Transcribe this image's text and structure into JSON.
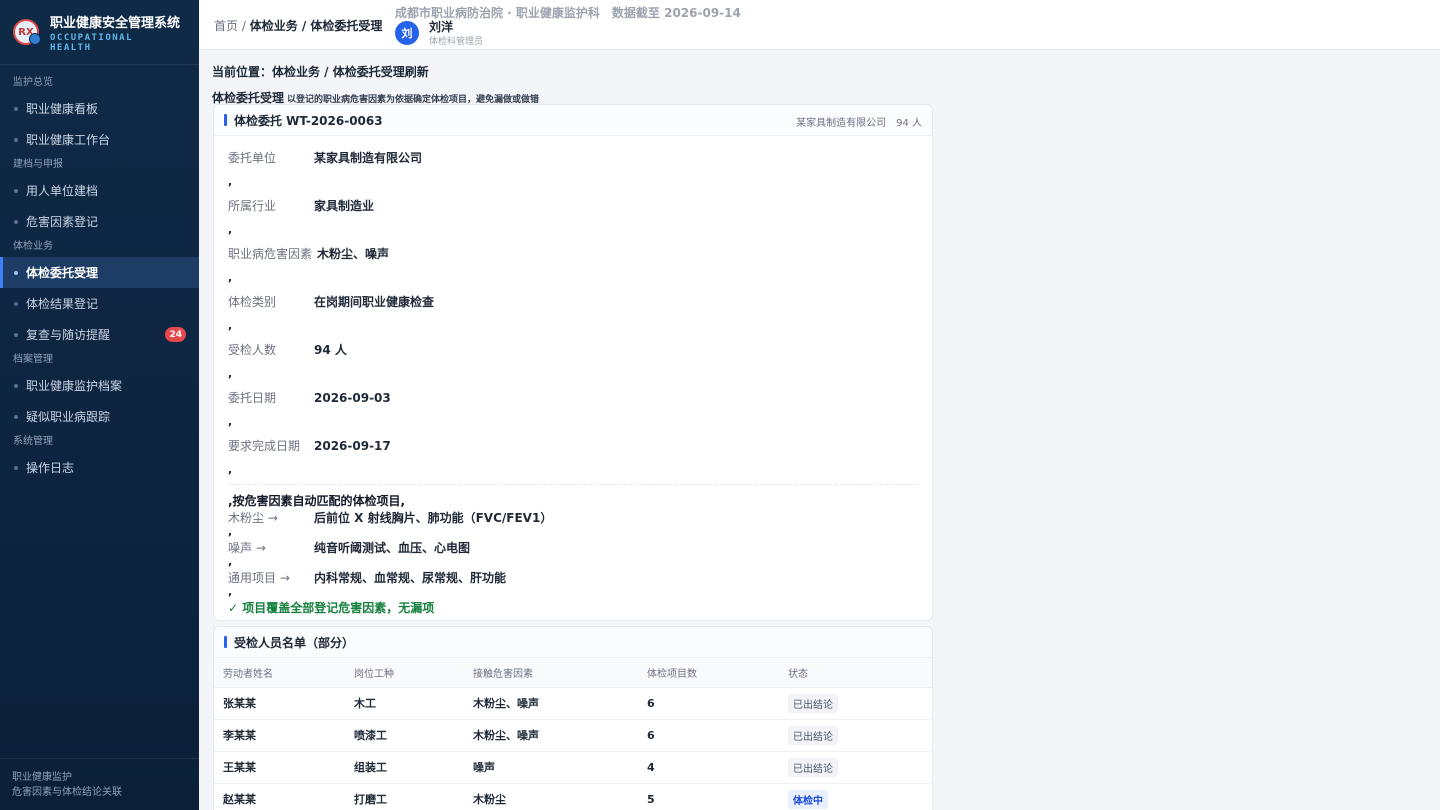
{
  "brand": {
    "title": "职业健康安全管理系统",
    "subtitle_line1": "OCCUPATIONAL",
    "subtitle_line2": "HEALTH",
    "logo_text": "RX"
  },
  "sidebar": {
    "groups": [
      {
        "title": "监护总览",
        "items": [
          {
            "label": "职业健康看板"
          },
          {
            "label": "职业健康工作台"
          }
        ]
      },
      {
        "title": "建档与申报",
        "items": [
          {
            "label": "用人单位建档"
          },
          {
            "label": "危害因素登记"
          }
        ]
      },
      {
        "title": "体检业务",
        "items": [
          {
            "label": "体检委托受理"
          },
          {
            "label": "体检结果登记"
          },
          {
            "label": "复查与随访提醒",
            "badge": "24"
          }
        ]
      },
      {
        "title": "档案管理",
        "items": [
          {
            "label": "职业健康监护档案"
          },
          {
            "label": "疑似职业病跟踪"
          }
        ]
      },
      {
        "title": "系统管理",
        "items": [
          {
            "label": "操作日志"
          }
        ]
      }
    ],
    "active": "体检委托受理",
    "footer_line1": "职业健康监护",
    "footer_line2": "危害因素与体检结论关联"
  },
  "topbar": {
    "crumb_home": "首页",
    "crumb_sep": " / ",
    "crumb_current": "体检业务 / 体检委托受理",
    "org": "成都市职业病防治院 · 职业健康监护科　数据截至 2026-09-14",
    "avatar": "刘",
    "user_name": "刘洋",
    "user_role": "体检科管理员"
  },
  "main": {
    "location": "当前位置：体检业务 / 体检委托受理刷新",
    "subhead_title": "体检委托受理",
    "subhead_note": "以登记的职业病危害因素为依据确定体检项目，避免漏做或做错"
  },
  "order": {
    "title": "体检委托 WT-2026-0063",
    "meta": "某家具制造有限公司　94 人",
    "fields": [
      {
        "k": "委托单位",
        "v": "某家具制造有限公司"
      },
      {
        "k": "所属行业",
        "v": "家具制造业"
      },
      {
        "k": "职业病危害因素",
        "v": "木粉尘、噪声"
      },
      {
        "k": "体检类别",
        "v": "在岗期间职业健康检查"
      },
      {
        "k": "受检人数",
        "v": "94 人"
      },
      {
        "k": "委托日期",
        "v": "2026-09-03"
      },
      {
        "k": "要求完成日期",
        "v": "2026-09-17"
      }
    ],
    "sep": ",",
    "match_title": ",按危害因素自动匹配的体检项目,",
    "matches": [
      {
        "k": "木粉尘 →",
        "v": "后前位 X 射线胸片、肺功能（FVC/FEV1）"
      },
      {
        "k": "噪声 →",
        "v": "纯音听阈测试、血压、心电图"
      },
      {
        "k": "通用项目 →",
        "v": "内科常规、血常规、尿常规、肝功能"
      }
    ],
    "ok": "✓ 项目覆盖全部登记危害因素，无漏项"
  },
  "roster": {
    "title": "受检人员名单（部分）",
    "headers": [
      "劳动者姓名",
      "岗位工种",
      "接触危害因素",
      "体检项目数",
      "状态"
    ],
    "rows": [
      {
        "name": "张某某",
        "job": "木工",
        "hazard": "木粉尘、噪声",
        "count": "6",
        "status": "已出结论"
      },
      {
        "name": "李某某",
        "job": "喷漆工",
        "hazard": "木粉尘、噪声",
        "count": "6",
        "status": "已出结论"
      },
      {
        "name": "王某某",
        "job": "组装工",
        "hazard": "噪声",
        "count": "4",
        "status": "已出结论"
      },
      {
        "name": "赵某某",
        "job": "打磨工",
        "hazard": "木粉尘",
        "count": "5",
        "status": "体检中"
      }
    ]
  },
  "colors": {
    "accent": "#2563eb",
    "sidebar": "#0f2a47",
    "success": "#15803d",
    "badge": "#e5484d"
  }
}
